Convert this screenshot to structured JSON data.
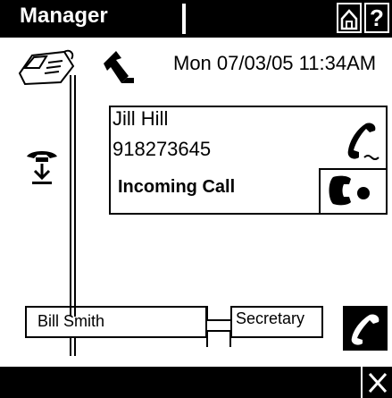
{
  "header": {
    "title": "Manager",
    "help_label": "?"
  },
  "datetime": "Mon 07/03/05 11:34AM",
  "incoming_call": {
    "caller_name": "Jill Hill",
    "caller_number": "918273645",
    "status": "Incoming Call"
  },
  "parties": {
    "left": "Bill Smith",
    "right": "Secretary"
  },
  "icons": {
    "home": "home-icon",
    "help": "help-icon",
    "phone": "desk-phone-icon",
    "back": "back-arrow-icon",
    "handset": "handset-ringing-icon",
    "pickup": "handset-answer-icon",
    "hold": "hold-transfer-icon",
    "bottom_handset": "handset-icon",
    "close": "close-icon"
  },
  "colors": {
    "background": "#ffffff",
    "foreground": "#000000",
    "bar": "#000000"
  }
}
